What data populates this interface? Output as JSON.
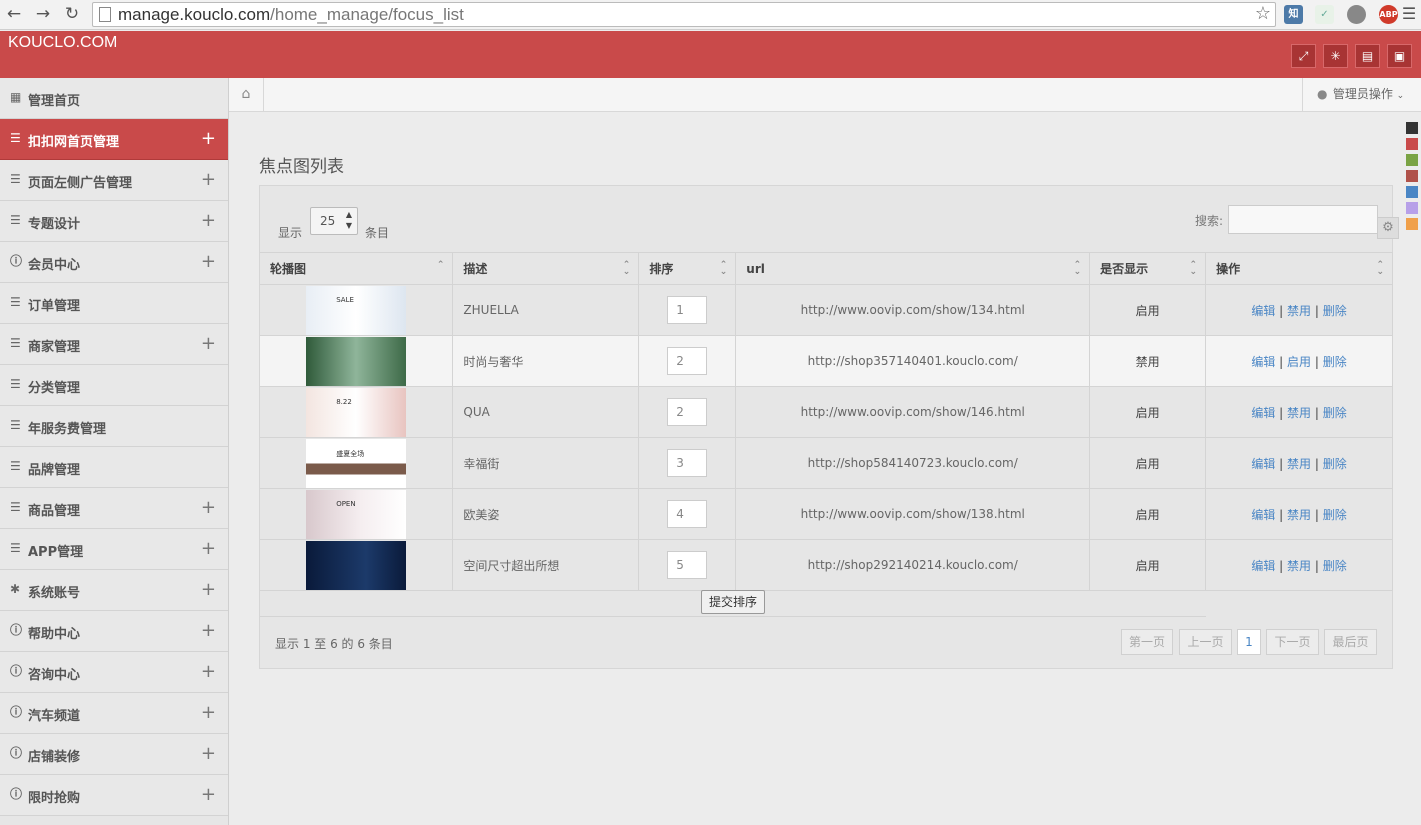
{
  "browser": {
    "url_host": "manage.kouclo.com",
    "url_path": "/home_manage/focus_list",
    "ext_zhi": "知",
    "ext_abp": "ABP"
  },
  "header": {
    "brand": "KOUCLO.COM"
  },
  "sidebar": {
    "items": [
      {
        "label": "管理首页",
        "icon": "grid-icon",
        "expand": false,
        "active": false
      },
      {
        "label": "扣扣网首页管理",
        "icon": "list-icon",
        "expand": true,
        "active": true
      },
      {
        "label": "页面左侧广告管理",
        "icon": "list-icon",
        "expand": true,
        "active": false
      },
      {
        "label": "专题设计",
        "icon": "list-icon",
        "expand": true,
        "active": false
      },
      {
        "label": "会员中心",
        "icon": "info-icon",
        "expand": true,
        "active": false
      },
      {
        "label": "订单管理",
        "icon": "list-icon",
        "expand": false,
        "active": false
      },
      {
        "label": "商家管理",
        "icon": "list-icon",
        "expand": true,
        "active": false
      },
      {
        "label": "分类管理",
        "icon": "list-icon",
        "expand": false,
        "active": false
      },
      {
        "label": "年服务费管理",
        "icon": "list-icon",
        "expand": false,
        "active": false
      },
      {
        "label": "品牌管理",
        "icon": "list-icon",
        "expand": false,
        "active": false
      },
      {
        "label": "商品管理",
        "icon": "list-icon",
        "expand": true,
        "active": false
      },
      {
        "label": "APP管理",
        "icon": "list-icon",
        "expand": true,
        "active": false
      },
      {
        "label": "系统账号",
        "icon": "gear-icon",
        "expand": true,
        "active": false
      },
      {
        "label": "帮助中心",
        "icon": "info-icon",
        "expand": true,
        "active": false
      },
      {
        "label": "咨询中心",
        "icon": "info-icon",
        "expand": true,
        "active": false
      },
      {
        "label": "汽车频道",
        "icon": "info-icon",
        "expand": true,
        "active": false
      },
      {
        "label": "店铺装修",
        "icon": "info-icon",
        "expand": true,
        "active": false
      },
      {
        "label": "限时抢购",
        "icon": "info-icon",
        "expand": true,
        "active": false
      }
    ]
  },
  "breadcrumb": {
    "admin_label": "管理员操作"
  },
  "main": {
    "title": "焦点图列表",
    "show_label": "显示",
    "page_size": "25",
    "items_label": "条目",
    "search_label": "搜索:",
    "columns": [
      "轮播图",
      "描述",
      "排序",
      "url",
      "是否显示",
      "操作"
    ],
    "rows": [
      {
        "desc": "ZHUELLA",
        "order": "1",
        "url": "http://www.oovip.com/show/134.html",
        "show": "启用",
        "op_edit": "编辑",
        "op_toggle": "禁用",
        "op_delete": "删除",
        "thumb_text": "SALE"
      },
      {
        "desc": "时尚与奢华",
        "order": "2",
        "url": "http://shop357140401.kouclo.com/",
        "show": "禁用",
        "op_edit": "编辑",
        "op_toggle": "启用",
        "op_delete": "删除",
        "thumb_text": ""
      },
      {
        "desc": "QUA",
        "order": "2",
        "url": "http://www.oovip.com/show/146.html",
        "show": "启用",
        "op_edit": "编辑",
        "op_toggle": "禁用",
        "op_delete": "删除",
        "thumb_text": "8.22"
      },
      {
        "desc": "幸福街",
        "order": "3",
        "url": "http://shop584140723.kouclo.com/",
        "show": "启用",
        "op_edit": "编辑",
        "op_toggle": "禁用",
        "op_delete": "删除",
        "thumb_text": "盛夏全场"
      },
      {
        "desc": "欧美姿",
        "order": "4",
        "url": "http://www.oovip.com/show/138.html",
        "show": "启用",
        "op_edit": "编辑",
        "op_toggle": "禁用",
        "op_delete": "删除",
        "thumb_text": "OPEN"
      },
      {
        "desc": "空间尺寸超出所想",
        "order": "5",
        "url": "http://shop292140214.kouclo.com/",
        "show": "启用",
        "op_edit": "编辑",
        "op_toggle": "禁用",
        "op_delete": "删除",
        "thumb_text": ""
      }
    ],
    "submit_label": "提交排序",
    "info": "显示 1 至 6 的 6 条目",
    "pagination": {
      "first": "第一页",
      "prev": "上一页",
      "current": "1",
      "next": "下一页",
      "last": "最后页"
    }
  },
  "theme_swatches": [
    "#333333",
    "#c94a4a",
    "#7aa344",
    "#b0524a",
    "#4a86c5",
    "#b7a0e8",
    "#f0a04a"
  ]
}
